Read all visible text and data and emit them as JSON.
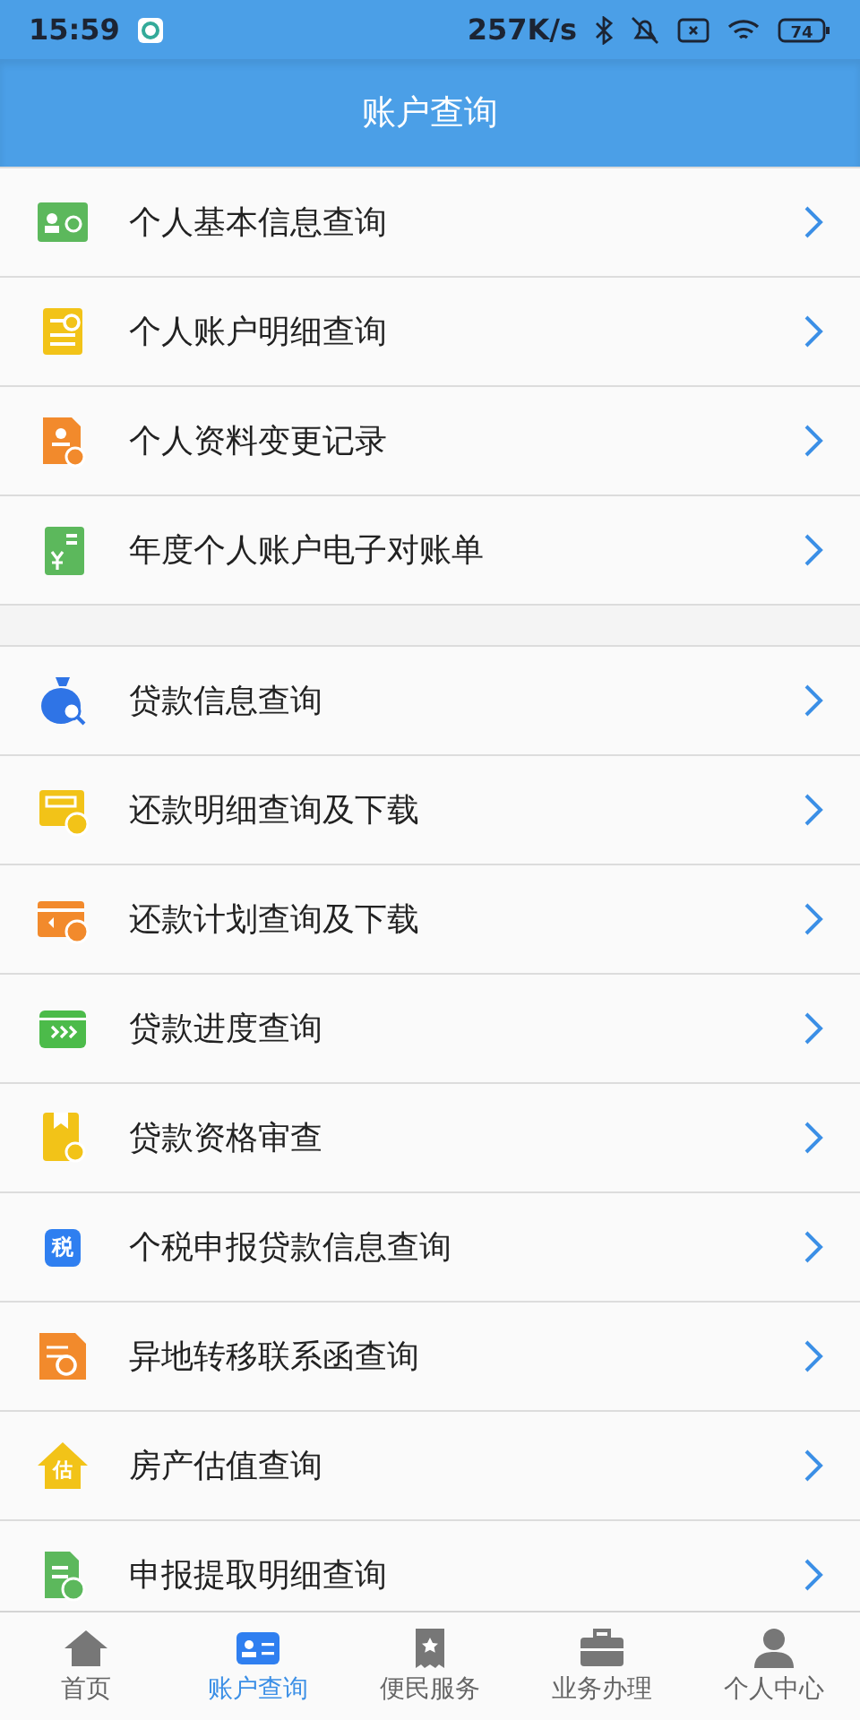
{
  "status_bar": {
    "time": "15:59",
    "speed": "257K/s",
    "battery": "74"
  },
  "header": {
    "title": "账户查询"
  },
  "groups": [
    {
      "items": [
        {
          "label": "个人基本信息查询",
          "kind": "id-card"
        },
        {
          "label": "个人账户明细查询",
          "kind": "doc-search"
        },
        {
          "label": "个人资料变更记录",
          "kind": "profile-doc"
        },
        {
          "label": "年度个人账户电子对账单",
          "kind": "yuan-doc"
        }
      ]
    },
    {
      "items": [
        {
          "label": "贷款信息查询",
          "kind": "money-bag"
        },
        {
          "label": "还款明细查询及下载",
          "kind": "card-repay"
        },
        {
          "label": "还款计划查询及下载",
          "kind": "card-clock"
        },
        {
          "label": "贷款进度查询",
          "kind": "card-progress"
        },
        {
          "label": "贷款资格审查",
          "kind": "book-search"
        },
        {
          "label": "个税申报贷款信息查询",
          "kind": "tax",
          "icon_text": "税"
        },
        {
          "label": "异地转移联系函查询",
          "kind": "transfer"
        },
        {
          "label": "房产估值查询",
          "kind": "house",
          "icon_text": "估"
        },
        {
          "label": "申报提取明细查询",
          "kind": "doc-upload"
        }
      ]
    }
  ],
  "tab_bar": [
    {
      "label": "首页",
      "kind": "home",
      "selected": false
    },
    {
      "label": "账户查询",
      "kind": "card",
      "selected": true
    },
    {
      "label": "便民服务",
      "kind": "ticket",
      "selected": false
    },
    {
      "label": "业务办理",
      "kind": "briefcase",
      "selected": false
    },
    {
      "label": "个人中心",
      "kind": "person",
      "selected": false
    }
  ]
}
